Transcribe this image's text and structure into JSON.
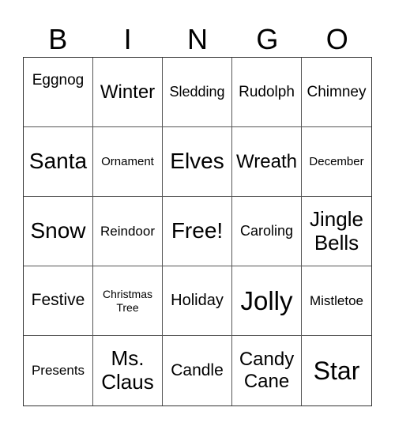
{
  "header": {
    "letters": [
      "B",
      "I",
      "N",
      "G",
      "O"
    ]
  },
  "card": {
    "rows": [
      [
        "Eggnog",
        "Winter",
        "Sledding",
        "Rudolph",
        "Chimney"
      ],
      [
        "Santa",
        "Ornament",
        "Elves",
        "Wreath",
        "December"
      ],
      [
        "Snow",
        "Reindoor",
        "Free!",
        "Caroling",
        "Jingle Bells"
      ],
      [
        "Festive",
        "Christmas Tree",
        "Holiday",
        "Jolly",
        "Mistletoe"
      ],
      [
        "Presents",
        "Ms. Claus",
        "Candle",
        "Candy Cane",
        "Star"
      ]
    ]
  }
}
